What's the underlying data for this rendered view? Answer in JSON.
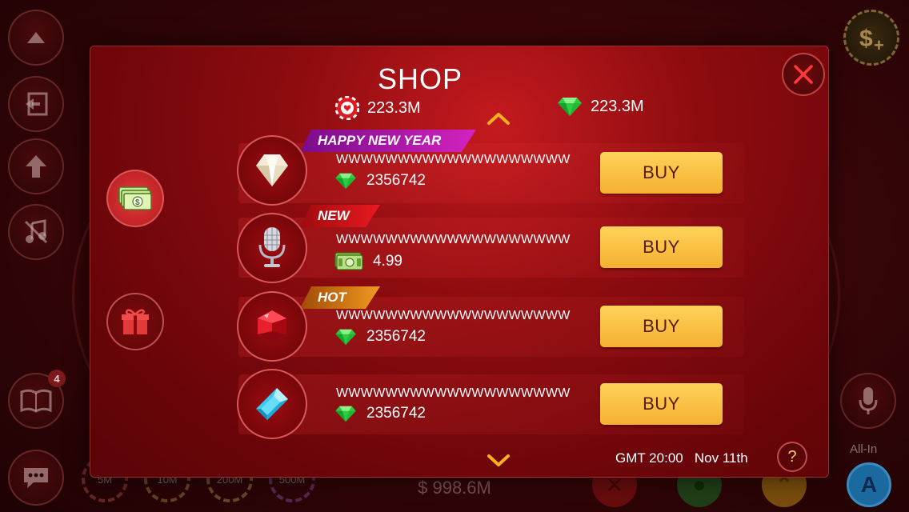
{
  "background": {
    "bottom_money": "$ 998.6M",
    "notification_count": "4",
    "allin_label": "All-In",
    "chips": [
      "5M",
      "10M",
      "200M",
      "500M"
    ],
    "action_a_label": "A"
  },
  "shop": {
    "title": "SHOP",
    "balances": {
      "chips": "223.3M",
      "gems": "223.3M"
    },
    "items": [
      {
        "ribbon": "HAPPY NEW YEAR",
        "icon": "diamond-icon",
        "name": "WWWWWWWWWWWWWWWWWWW",
        "price": "2356742",
        "currency": "gem-icon",
        "buy_label": "BUY"
      },
      {
        "ribbon": "NEW",
        "icon": "microphone-icon",
        "name": "WWWWWWWWWWWWWWWWWWW",
        "price": "4.99",
        "currency": "cash-icon",
        "buy_label": "BUY"
      },
      {
        "ribbon": "HOT",
        "icon": "ruby-icon",
        "name": "WWWWWWWWWWWWWWWWWWW",
        "price": "2356742",
        "currency": "gem-icon",
        "buy_label": "BUY"
      },
      {
        "ribbon": "",
        "icon": "sapphire-icon",
        "name": "WWWWWWWWWWWWWWWWWWW",
        "price": "2356742",
        "currency": "gem-icon",
        "buy_label": "BUY"
      }
    ],
    "footer": {
      "time": "GMT 20:00",
      "date": "Nov 11th",
      "help": "?"
    },
    "colors": {
      "buy_button": "#f4b030",
      "ribbon_happy_new_year": "#b0169c",
      "ribbon_new": "#d4141a",
      "ribbon_hot": "#d47a10",
      "gem": "#2ecc40"
    }
  }
}
